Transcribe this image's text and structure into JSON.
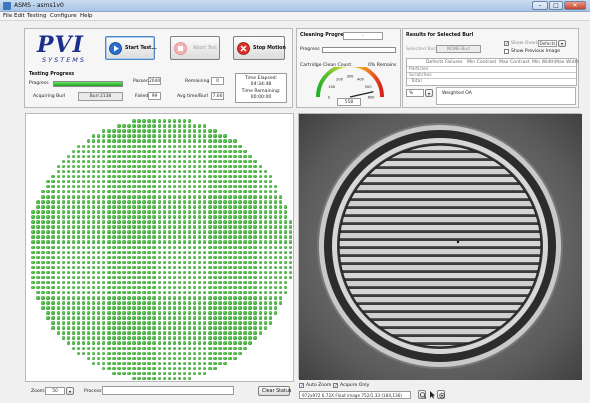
{
  "window": {
    "title": "ASMS - asms1v0",
    "minimize": "–",
    "maximize": "□",
    "close": "✕"
  },
  "menu": [
    "File",
    "Edit",
    "Testing",
    "Configure",
    "Help"
  ],
  "logo": {
    "text": "PVI",
    "sub": "SYSTEMS"
  },
  "toolbar": {
    "start_label": "Start Test...",
    "abort_label": "Abort Test",
    "stop_label": "Stop Motion"
  },
  "testing_progress": {
    "title": "Testing Progress",
    "progress_label": "Progress",
    "progress_fraction": 1.0,
    "acquiring_label": "Acquiring Burl",
    "acquiring_value": "Burl 2138",
    "passed_label": "Passed",
    "passed_value": "2040",
    "failed_label": "Failed",
    "failed_value": "99",
    "remaining_label": "Remaining",
    "remaining_value": "0",
    "avg_label": "Avg time/Burl",
    "avg_value": "7.66",
    "elapsed_label": "Time Elapsed:",
    "elapsed_value": "04:34:48",
    "time_remaining_label": "Time Remaining:",
    "time_remaining_value": "00:00:00"
  },
  "cleaning": {
    "title": "Cleaning Progress",
    "top_value": "-",
    "progress_label": "Progress",
    "progress_fraction": 0.0,
    "cartridge_label": "Cartridge Clean Count",
    "remains_label": "0% Remains",
    "gauge_ticks": [
      "0",
      "100",
      "200",
      "300",
      "400",
      "500",
      "600"
    ],
    "gauge_value": "558",
    "gauge_reading": 558
  },
  "results": {
    "title": "Results for Selected Burl",
    "selected_label": "Selected Burl",
    "selected_value": "NONE-Burl",
    "show_overlay_label": "Show Overlay",
    "overlay_option": "Defects",
    "show_previous_label": "Show Previous Image",
    "columns": [
      "Defects",
      "Failures",
      "Min Contrast",
      "Max Contrast",
      "Min Width",
      "Max Width"
    ],
    "rows": [
      "Particles",
      "Scratches",
      "Total"
    ],
    "unit": "%",
    "weighted_label": "Weighted OA"
  },
  "map": {
    "zoom_label": "Zoom:",
    "zoom_value": "50",
    "process_label": "Process:",
    "process_value": "",
    "clear_label": "Clear Status"
  },
  "image": {
    "auto_zoom_label": "Auto Zoom",
    "acquire_only_label": "Acquire Only",
    "status_text": "972x972 6.72X Float image 752/1.33   (184,136)"
  }
}
